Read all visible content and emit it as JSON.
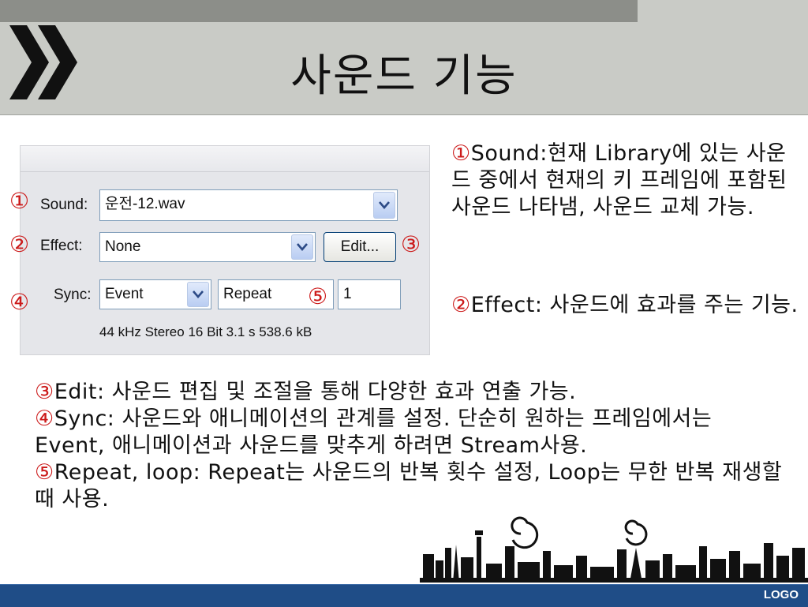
{
  "title": "사운드 기능",
  "panel": {
    "sound_label": "Sound:",
    "sound_value": "운전-12.wav",
    "effect_label": "Effect:",
    "effect_value": "None",
    "edit_label": "Edit...",
    "sync_label": "Sync:",
    "sync_value": "Event",
    "repeat_value": "Repeat",
    "repeat_count": "1",
    "info": "44 kHz Stereo 16 Bit 3.1 s 538.6 kB"
  },
  "markers": [
    "①",
    "②",
    "③",
    "④",
    "⑤"
  ],
  "right_text": [
    {
      "marker": "①",
      "text": "Sound:현재 Library에 있는 사운드 중에서 현재의 키 프레임에 포함된 사운드 나타냄, 사운드 교체 가능."
    },
    {
      "marker": "②",
      "text": "Effect: 사운드에 효과를 주는 기능."
    }
  ],
  "bottom_text": [
    {
      "marker": "③",
      "text": "Edit: 사운드 편집 및 조절을 통해 다양한 효과 연출 가능."
    },
    {
      "marker": "④",
      "text": "Sync: 사운드와 애니메이션의 관계를 설정. 단순히 원하는 프레임에서는 Event, 애니메이션과 사운드를 맞추게 하려면 Stream사용."
    },
    {
      "marker": "⑤",
      "text": "Repeat, loop: Repeat는 사운드의 반복 횟수 설정, Loop는 무한 반복 재생할 때 사용."
    }
  ],
  "footer": {
    "logo": "LOGO"
  },
  "colors": {
    "accent": "#cc1a1a",
    "footer": "#1f4d87",
    "title_bar": "#c9cbc6"
  },
  "icons": [
    "double-chevron-icon",
    "chevron-down-icon",
    "skyline-graphic"
  ]
}
